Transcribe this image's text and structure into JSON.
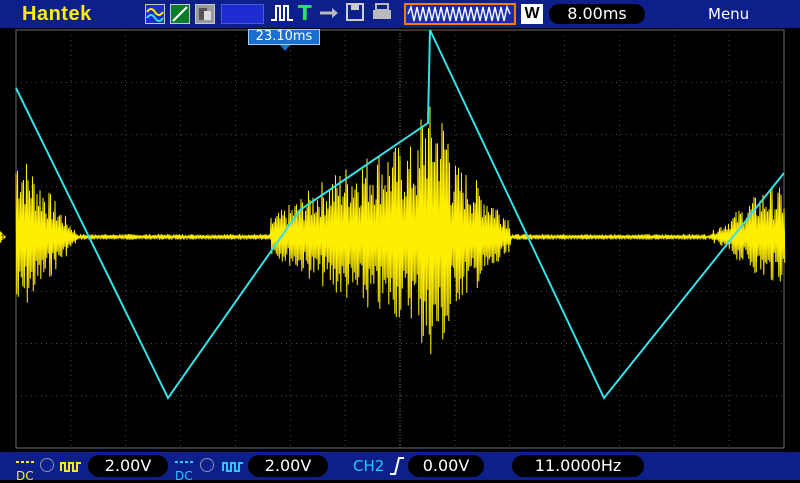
{
  "header": {
    "brand": "Hantek",
    "timebase": "8.00ms",
    "menu_label": "Menu",
    "w_label": "W"
  },
  "trigger_time": "23.10ms",
  "footer": {
    "ch1_coupling": "DC",
    "ch1_volts": "2.00V",
    "ch2_coupling": "DC",
    "ch2_volts": "2.00V",
    "trigger_source": "CH2",
    "trigger_level": "0.00V",
    "frequency": "11.0000Hz"
  },
  "colors": {
    "ch1": "#ffee00",
    "ch2": "#35e0e6",
    "bar_background": "#0d1f8a",
    "grid": "#5a5a5a"
  },
  "icons": [
    "run-stop-icon",
    "waveform-icon",
    "line-icon",
    "persist-icon",
    "pulse-icon",
    "trigger-t-icon",
    "cursor-icon",
    "save-icon",
    "print-icon",
    "usb-icon",
    "acquire-waveform-icon",
    "rising-edge-icon",
    "invert-icon",
    "bandwidth-icon"
  ]
}
